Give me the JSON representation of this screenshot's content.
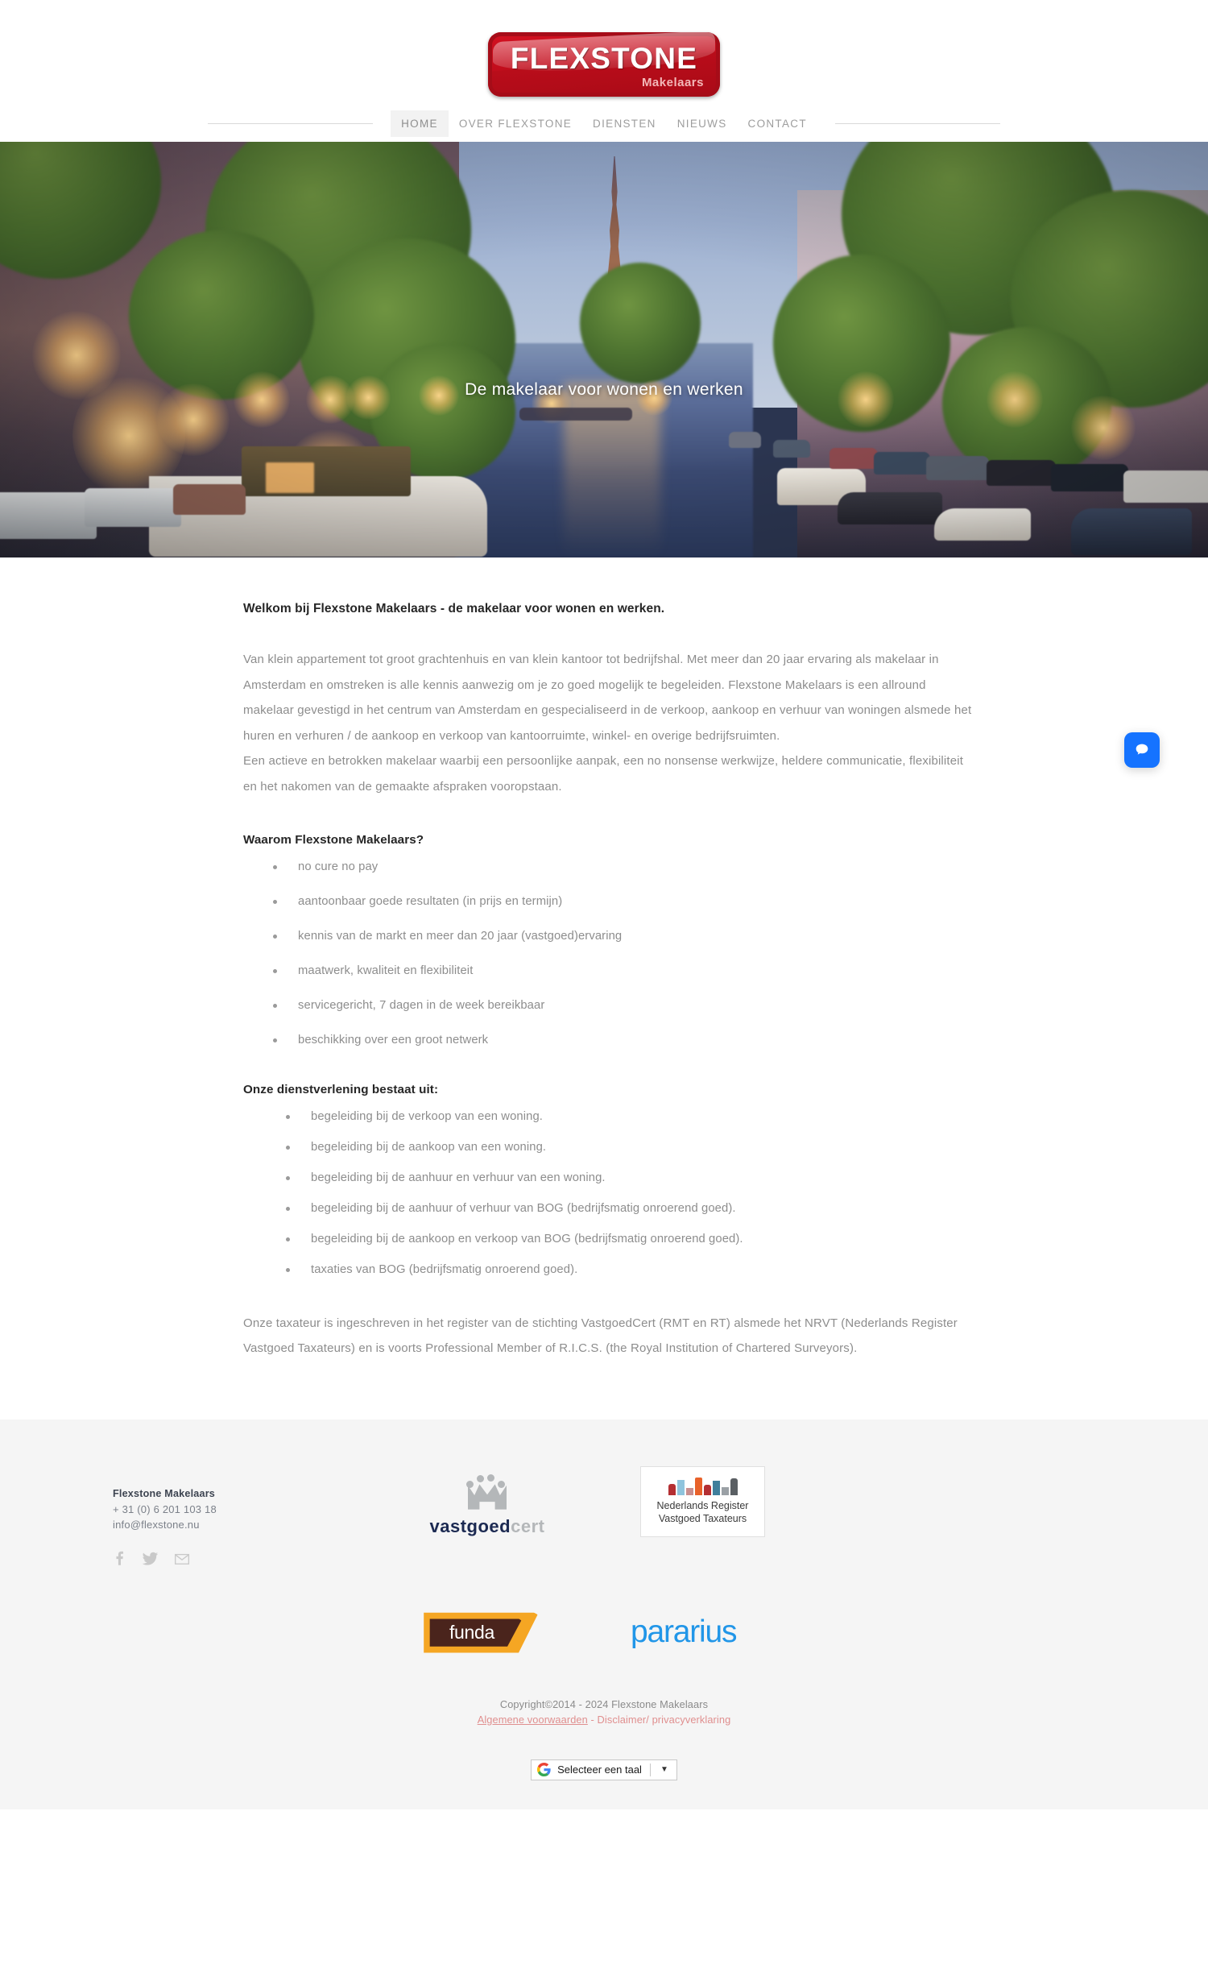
{
  "brand": {
    "logo_main": "FLEXSTONE",
    "logo_sub": "Makelaars",
    "accent_red": "#c10d1c"
  },
  "nav": {
    "items": [
      {
        "label": "HOME",
        "active": true
      },
      {
        "label": "OVER FLEXSTONE",
        "active": false
      },
      {
        "label": "DIENSTEN",
        "active": false
      },
      {
        "label": "NIEUWS",
        "active": false
      },
      {
        "label": "CONTACT",
        "active": false
      }
    ]
  },
  "hero": {
    "title": "De makelaar voor wonen en werken",
    "image_alt": "Amsterdam canal at dusk"
  },
  "main": {
    "lead": "Welkom bij Flexstone Makelaars - de makelaar voor wonen en werken.",
    "paragraph_1": "Van klein appartement tot groot grachtenhuis en van klein kantoor tot bedrijfshal. Met meer dan 20 jaar ervaring als makelaar in Amsterdam en omstreken is alle kennis aanwezig om je zo goed mogelijk te begeleiden. Flexstone Makelaars is een allround makelaar gevestigd in het centrum van Amsterdam en gespecialiseerd in de verkoop, aankoop en verhuur van woningen alsmede het huren en verhuren / de aankoop en verkoop van kantoorruimte, winkel- en overige bedrijfsruimten.",
    "paragraph_2": "Een actieve en betrokken makelaar waarbij een persoonlijke aanpak, een no nonsense werkwijze, heldere communicatie, flexibiliteit en het nakomen van de gemaakte afspraken vooropstaan.",
    "why_heading": "Waarom Flexstone Makelaars?",
    "why_items": [
      "no cure no pay",
      "aantoonbaar goede resultaten (in prijs en termijn)",
      "kennis van de markt en meer dan 20 jaar (vastgoed)ervaring",
      "maatwerk, kwaliteit en flexibiliteit",
      "servicegericht, 7 dagen in de week bereikbaar",
      "beschikking over een groot netwerk"
    ],
    "services_heading": "Onze dienstverlening bestaat uit:",
    "services_items": [
      "begeleiding bij de verkoop van een woning.",
      "begeleiding bij de aankoop van een woning.",
      "begeleiding bij de aanhuur en verhuur van een woning.",
      "begeleiding bij de aanhuur of verhuur van BOG (bedrijfsmatig onroerend goed).",
      "begeleiding bij de aankoop en verkoop van BOG (bedrijfsmatig onroerend goed).",
      "taxaties van BOG (bedrijfsmatig onroerend goed)."
    ],
    "closing": "Onze taxateur is ingeschreven in het register van de stichting VastgoedCert (RMT en RT) alsmede het NRVT (Nederlands Register Vastgoed Taxateurs) en is voorts Professional Member of R.I.C.S. (the Royal Institution of Chartered Surveyors)."
  },
  "chat": {
    "icon": "chat-bubble-icon",
    "color": "#1573ff"
  },
  "footer": {
    "company": "Flexstone Makelaars",
    "phone": "+ 31 (0) 6 201 103 18",
    "email": "info@flexstone.nu",
    "social": [
      {
        "name": "facebook-icon"
      },
      {
        "name": "twitter-icon"
      },
      {
        "name": "email-icon"
      }
    ],
    "badges": {
      "vastgoedcert": {
        "part_a": "vastgoed",
        "part_b": "cert",
        "icon": "crown-icon"
      },
      "nrvt": {
        "line1": "Nederlands Register",
        "line2": "Vastgoed  Taxateurs",
        "icon": "skyline-icon"
      }
    },
    "partners": {
      "funda": "funda",
      "pararius": "pararius"
    },
    "copyright": "Copyright©2014 - 2024 Flexstone Makelaars",
    "legal_terms": "Algemene voorwaarden",
    "legal_sep": " - ",
    "legal_disclaimer": "Disclaimer/ privacyverklaring"
  },
  "language": {
    "label": "Selecteer een taal",
    "caret": "▼",
    "icon": "google-g-icon"
  }
}
